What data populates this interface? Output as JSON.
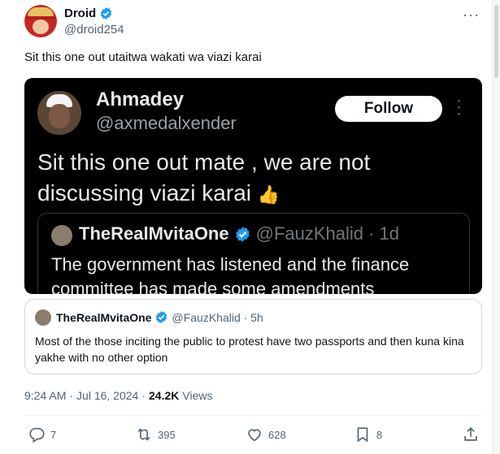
{
  "post": {
    "author_name": "Droid",
    "author_handle": "@droid254",
    "text": "Sit this one out utaitwa wakati wa viazi karai",
    "more_icon": "more-horizontal-icon"
  },
  "embedded_screenshot": {
    "author_name": "Ahmadey",
    "author_handle": "@axmedalxender",
    "follow_label": "Follow",
    "text": "Sit this one out mate , we are not discussing viazi karai",
    "emoji": "👍",
    "inner_quote": {
      "author_name": "TheRealMvitaOne",
      "author_handle": "@FauzKhalid · 1d",
      "text": "The government has listened and the finance committee has made some amendments"
    }
  },
  "quoted_post": {
    "author_name": "TheRealMvitaOne",
    "author_handle": "@FauzKhalid · 5h",
    "text": "Most of the those inciting the public to protest have two passports and then kuna kina yakhe with no other option"
  },
  "meta": {
    "time": "9:24 AM",
    "separator1": "·",
    "date": "Jul 16, 2024",
    "separator2": "·",
    "views_count": "24.2K",
    "views_label": "Views"
  },
  "actions": {
    "replies": "7",
    "reposts": "395",
    "likes": "628",
    "bookmarks": "8"
  },
  "colors": {
    "verified": "#1d9bf0",
    "text": "#0f1419",
    "secondary": "#536471"
  }
}
